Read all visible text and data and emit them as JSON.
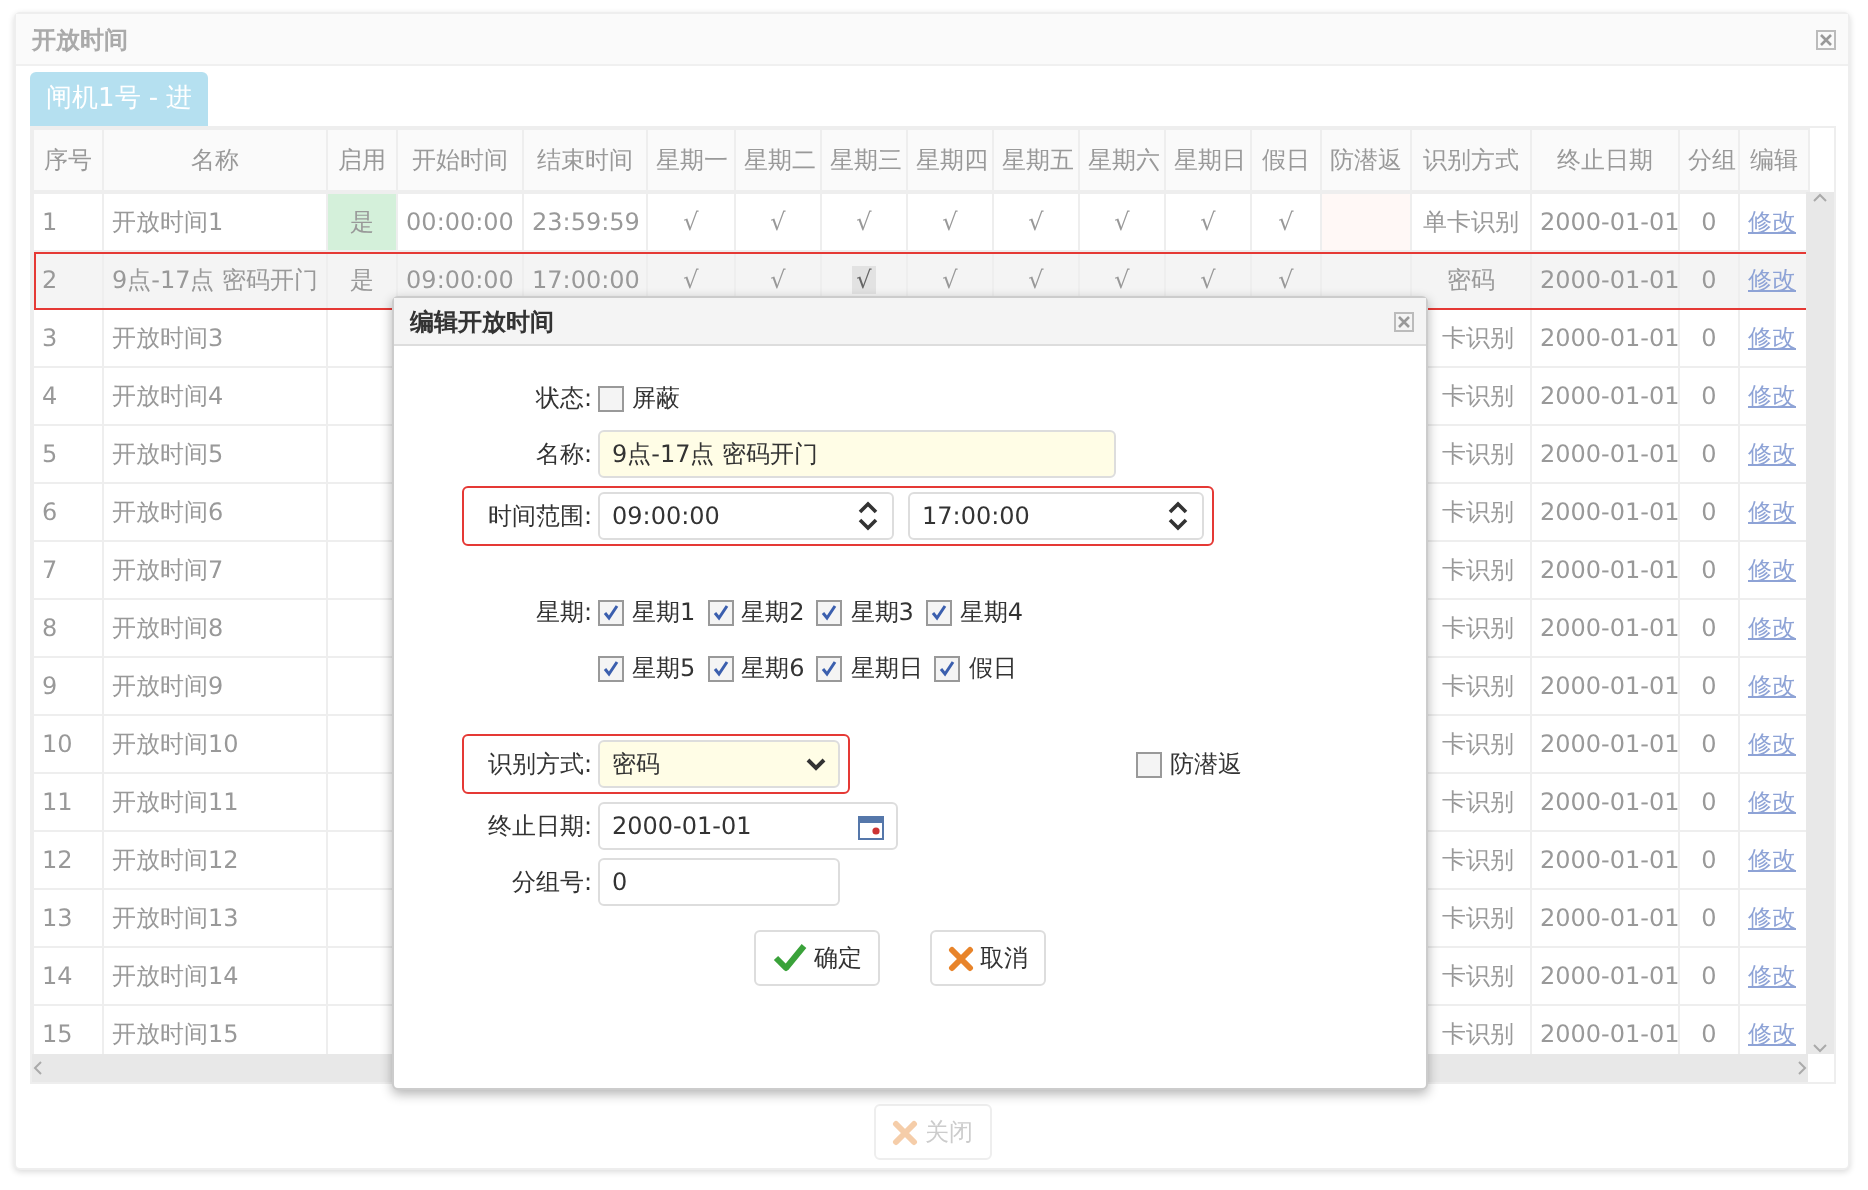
{
  "window": {
    "title": "开放时间"
  },
  "tabs": [
    {
      "label": "闸机1号 - 进",
      "selected": true
    }
  ],
  "table": {
    "columns": [
      "序号",
      "名称",
      "启用",
      "开始时间",
      "结束时间",
      "星期一",
      "星期二",
      "星期三",
      "星期四",
      "星期五",
      "星期六",
      "星期日",
      "假日",
      "防潜返",
      "识别方式",
      "终止日期",
      "分组",
      "编辑"
    ],
    "rows": [
      {
        "kind": "full",
        "highlighted": false,
        "index": "1",
        "name": "开放时间1",
        "enabled": "是",
        "start": "00:00:00",
        "end": "23:59:59",
        "days": [
          {
            "text": "√",
            "highlighted": false
          },
          {
            "text": "√",
            "highlighted": false
          },
          {
            "text": "√",
            "highlighted": false
          },
          {
            "text": "√",
            "highlighted": false
          },
          {
            "text": "√",
            "highlighted": false
          },
          {
            "text": "√",
            "highlighted": false
          },
          {
            "text": "√",
            "highlighted": false
          },
          {
            "text": "√",
            "highlighted": false
          }
        ],
        "method": "单卡识别",
        "end_date": "2000-01-01",
        "group": "0",
        "edit": "修改"
      },
      {
        "kind": "full",
        "highlighted": true,
        "index": "2",
        "name": "9点-17点 密码开门",
        "enabled": "是",
        "start": "09:00:00",
        "end": "17:00:00",
        "days": [
          {
            "text": "√",
            "highlighted": false
          },
          {
            "text": "√",
            "highlighted": false
          },
          {
            "text": "√",
            "highlighted": true
          },
          {
            "text": "√",
            "highlighted": false
          },
          {
            "text": "√",
            "highlighted": false
          },
          {
            "text": "√",
            "highlighted": false
          },
          {
            "text": "√",
            "highlighted": false
          },
          {
            "text": "√",
            "highlighted": false
          }
        ],
        "method": "密码",
        "end_date": "2000-01-01",
        "group": "0",
        "edit": "修改"
      },
      {
        "kind": "partial",
        "highlighted": false,
        "index": "3",
        "name": "开放时间3",
        "method": "卡识别",
        "end_date": "2000-01-01",
        "group": "0",
        "edit": "修改"
      },
      {
        "kind": "partial",
        "highlighted": false,
        "index": "4",
        "name": "开放时间4",
        "method": "卡识别",
        "end_date": "2000-01-01",
        "group": "0",
        "edit": "修改"
      },
      {
        "kind": "partial",
        "highlighted": false,
        "index": "5",
        "name": "开放时间5",
        "method": "卡识别",
        "end_date": "2000-01-01",
        "group": "0",
        "edit": "修改"
      },
      {
        "kind": "partial",
        "highlighted": false,
        "index": "6",
        "name": "开放时间6",
        "method": "卡识别",
        "end_date": "2000-01-01",
        "group": "0",
        "edit": "修改"
      },
      {
        "kind": "partial",
        "highlighted": false,
        "index": "7",
        "name": "开放时间7",
        "method": "卡识别",
        "end_date": "2000-01-01",
        "group": "0",
        "edit": "修改"
      },
      {
        "kind": "partial",
        "highlighted": false,
        "index": "8",
        "name": "开放时间8",
        "method": "卡识别",
        "end_date": "2000-01-01",
        "group": "0",
        "edit": "修改"
      },
      {
        "kind": "partial",
        "highlighted": false,
        "index": "9",
        "name": "开放时间9",
        "method": "卡识别",
        "end_date": "2000-01-01",
        "group": "0",
        "edit": "修改"
      },
      {
        "kind": "partial",
        "highlighted": false,
        "index": "10",
        "name": "开放时间10",
        "method": "卡识别",
        "end_date": "2000-01-01",
        "group": "0",
        "edit": "修改"
      },
      {
        "kind": "partial",
        "highlighted": false,
        "index": "11",
        "name": "开放时间11",
        "method": "卡识别",
        "end_date": "2000-01-01",
        "group": "0",
        "edit": "修改"
      },
      {
        "kind": "partial",
        "highlighted": false,
        "index": "12",
        "name": "开放时间12",
        "method": "卡识别",
        "end_date": "2000-01-01",
        "group": "0",
        "edit": "修改"
      },
      {
        "kind": "partial",
        "highlighted": false,
        "index": "13",
        "name": "开放时间13",
        "method": "卡识别",
        "end_date": "2000-01-01",
        "group": "0",
        "edit": "修改"
      },
      {
        "kind": "partial",
        "highlighted": false,
        "index": "14",
        "name": "开放时间14",
        "method": "卡识别",
        "end_date": "2000-01-01",
        "group": "0",
        "edit": "修改"
      },
      {
        "kind": "partial",
        "highlighted": false,
        "index": "15",
        "name": "开放时间15",
        "method": "卡识别",
        "end_date": "2000-01-01",
        "group": "0",
        "edit": "修改"
      }
    ]
  },
  "dialog": {
    "title": "编辑开放时间",
    "fields": [
      {
        "kind": "checkbox",
        "label": "状态:",
        "option": "屏蔽",
        "checked": false
      },
      {
        "kind": "text",
        "label": "名称:",
        "value": "9点-17点 密码开门",
        "required": true
      },
      {
        "kind": "time_range",
        "label": "时间范围:",
        "from": "09:00:00",
        "to": "17:00:00",
        "highlighted": true
      },
      {
        "kind": "weekdays",
        "label": "星期:",
        "days": [
          {
            "label": "星期1",
            "checked": true
          },
          {
            "label": "星期2",
            "checked": true
          },
          {
            "label": "星期3",
            "checked": true
          },
          {
            "label": "星期4",
            "checked": true
          },
          {
            "label": "星期5",
            "checked": true
          },
          {
            "label": "星期6",
            "checked": true
          },
          {
            "label": "星期日",
            "checked": true
          },
          {
            "label": "假日",
            "checked": true
          }
        ]
      },
      {
        "kind": "select",
        "label": "识别方式:",
        "value": "密码",
        "required": true,
        "highlighted": true,
        "side_check": {
          "label": "防潜返",
          "checked": false
        }
      },
      {
        "kind": "date",
        "label": "终止日期:",
        "value": "2000-01-01"
      },
      {
        "kind": "text",
        "label": "分组号:",
        "value": "0",
        "required": false
      }
    ],
    "buttons": [
      {
        "kind": "ok",
        "label": "确定"
      },
      {
        "kind": "cancel",
        "label": "取消"
      }
    ]
  },
  "footer_button": {
    "label": "关闭",
    "disabled": true
  }
}
